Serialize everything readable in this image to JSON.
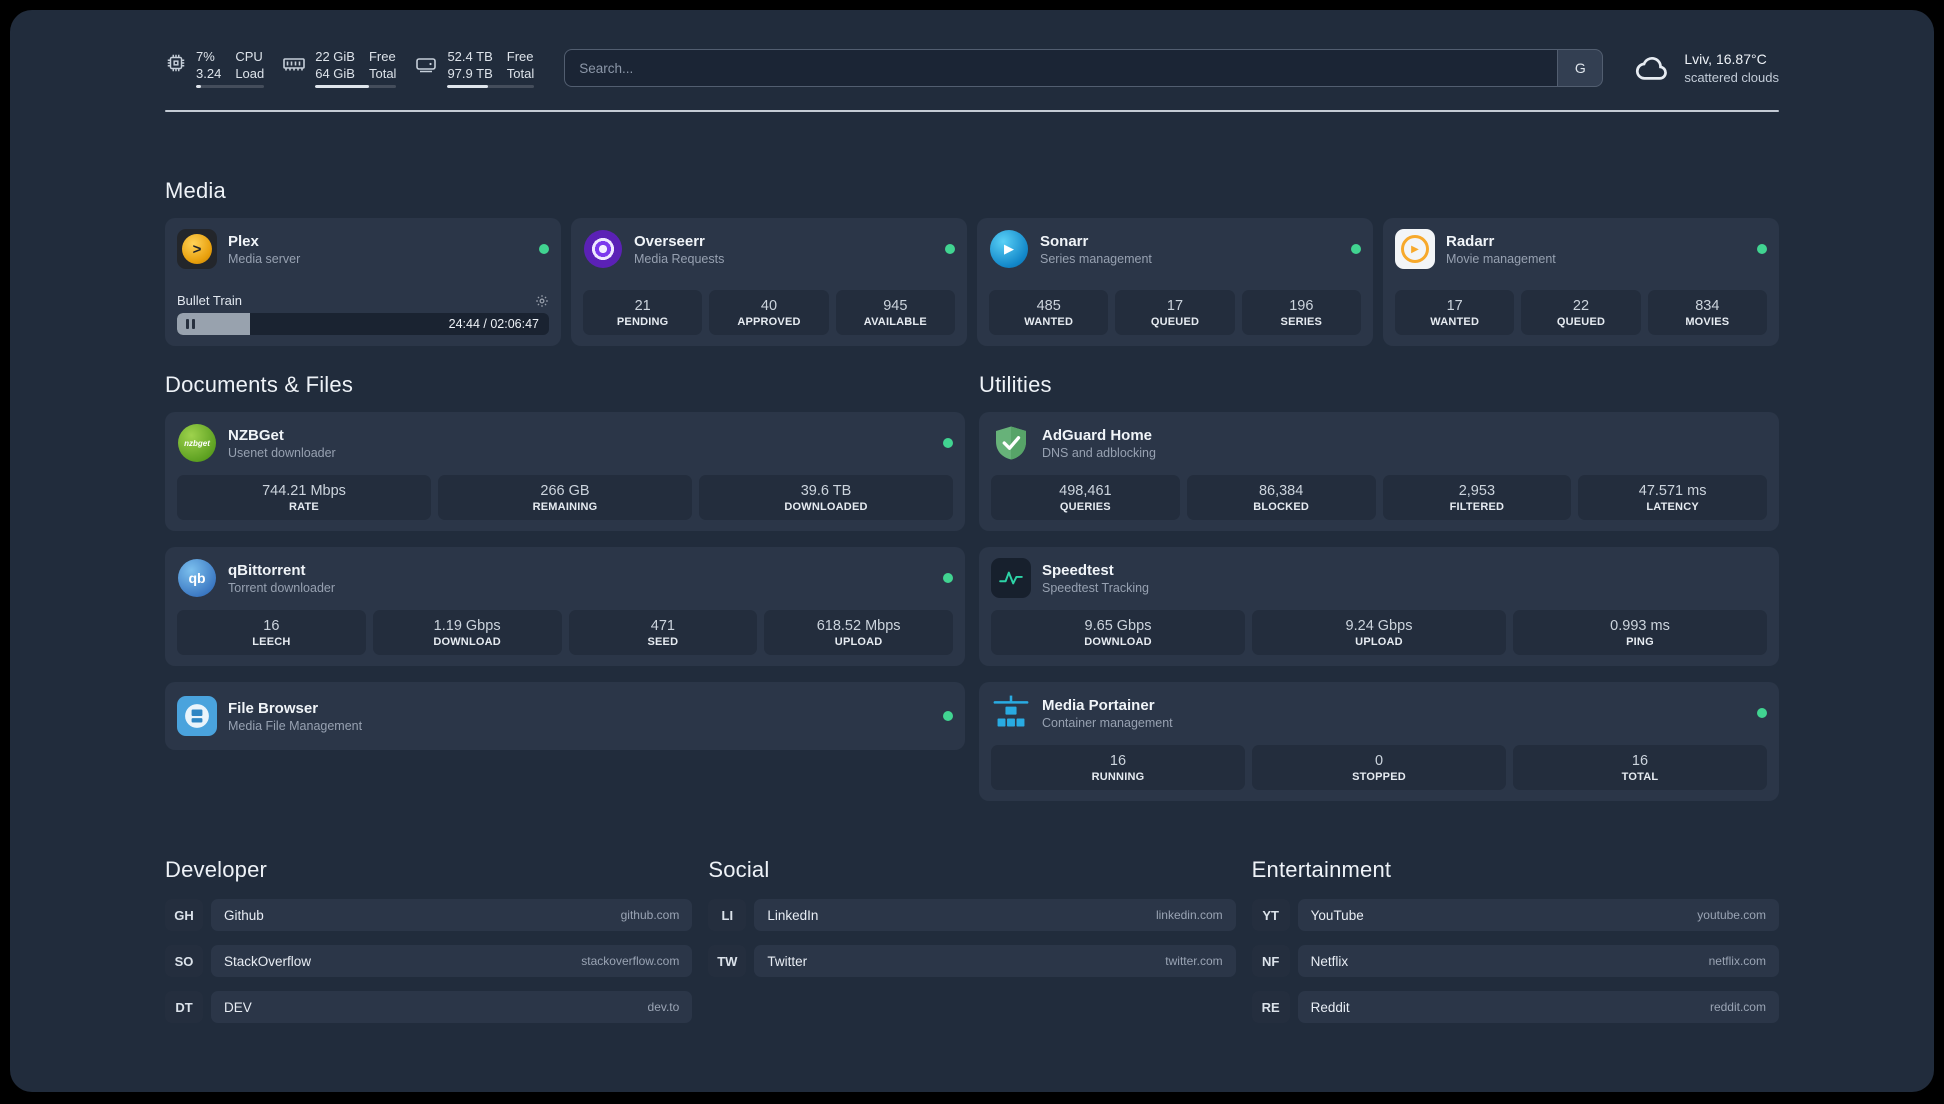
{
  "colors": {
    "status_online": "#41d491",
    "accent_blue": "#29abe2",
    "panel_bg": "#212c3c",
    "card_bg": "#2b3648"
  },
  "topbar": {
    "cpu": {
      "rows": [
        {
          "value": "7%",
          "label": "CPU"
        },
        {
          "value": "3.24",
          "label": "Load"
        }
      ],
      "bar_pct": 7
    },
    "memory": {
      "rows": [
        {
          "value": "22 GiB",
          "label": "Free"
        },
        {
          "value": "64 GiB",
          "label": "Total"
        }
      ],
      "bar_pct": 66
    },
    "disk": {
      "rows": [
        {
          "value": "52.4 TB",
          "label": "Free"
        },
        {
          "value": "97.9 TB",
          "label": "Total"
        }
      ],
      "bar_pct": 47
    },
    "search": {
      "placeholder": "Search...",
      "provider_label": "G"
    },
    "weather": {
      "location": "Lviv, 16.87°C",
      "condition": "scattered clouds"
    }
  },
  "media": {
    "title": "Media",
    "cards": [
      {
        "name": "Plex",
        "subtitle": "Media server",
        "status": "online",
        "player": {
          "title": "Bullet Train",
          "time": "24:44 / 02:06:47",
          "progress_pct": 19.5
        }
      },
      {
        "name": "Overseerr",
        "subtitle": "Media Requests",
        "status": "online",
        "stats": [
          {
            "value": "21",
            "label": "PENDING"
          },
          {
            "value": "40",
            "label": "APPROVED"
          },
          {
            "value": "945",
            "label": "AVAILABLE"
          }
        ]
      },
      {
        "name": "Sonarr",
        "subtitle": "Series management",
        "status": "online",
        "stats": [
          {
            "value": "485",
            "label": "WANTED"
          },
          {
            "value": "17",
            "label": "QUEUED"
          },
          {
            "value": "196",
            "label": "SERIES"
          }
        ]
      },
      {
        "name": "Radarr",
        "subtitle": "Movie management",
        "status": "online",
        "stats": [
          {
            "value": "17",
            "label": "WANTED"
          },
          {
            "value": "22",
            "label": "QUEUED"
          },
          {
            "value": "834",
            "label": "MOVIES"
          }
        ]
      }
    ]
  },
  "documents": {
    "title": "Documents & Files",
    "cards": [
      {
        "name": "NZBGet",
        "subtitle": "Usenet downloader",
        "status": "online",
        "stats": [
          {
            "value": "744.21 Mbps",
            "label": "RATE"
          },
          {
            "value": "266 GB",
            "label": "REMAINING"
          },
          {
            "value": "39.6 TB",
            "label": "DOWNLOADED"
          }
        ]
      },
      {
        "name": "qBittorrent",
        "subtitle": "Torrent downloader",
        "status": "online",
        "stats": [
          {
            "value": "16",
            "label": "LEECH"
          },
          {
            "value": "1.19 Gbps",
            "label": "DOWNLOAD"
          },
          {
            "value": "471",
            "label": "SEED"
          },
          {
            "value": "618.52 Mbps",
            "label": "UPLOAD"
          }
        ]
      },
      {
        "name": "File Browser",
        "subtitle": "Media File Management",
        "status": "online"
      }
    ]
  },
  "utilities": {
    "title": "Utilities",
    "cards": [
      {
        "name": "AdGuard Home",
        "subtitle": "DNS and adblocking",
        "stats": [
          {
            "value": "498,461",
            "label": "QUERIES"
          },
          {
            "value": "86,384",
            "label": "BLOCKED"
          },
          {
            "value": "2,953",
            "label": "FILTERED"
          },
          {
            "value": "47.571 ms",
            "label": "LATENCY"
          }
        ]
      },
      {
        "name": "Speedtest",
        "subtitle": "Speedtest Tracking",
        "stats": [
          {
            "value": "9.65 Gbps",
            "label": "DOWNLOAD"
          },
          {
            "value": "9.24 Gbps",
            "label": "UPLOAD"
          },
          {
            "value": "0.993 ms",
            "label": "PING"
          }
        ]
      },
      {
        "name": "Media Portainer",
        "subtitle": "Container management",
        "status": "online",
        "stats": [
          {
            "value": "16",
            "label": "RUNNING"
          },
          {
            "value": "0",
            "label": "STOPPED"
          },
          {
            "value": "16",
            "label": "TOTAL"
          }
        ]
      }
    ]
  },
  "bookmarks": [
    {
      "title": "Developer",
      "links": [
        {
          "abbr": "GH",
          "name": "Github",
          "domain": "github.com"
        },
        {
          "abbr": "SO",
          "name": "StackOverflow",
          "domain": "stackoverflow.com"
        },
        {
          "abbr": "DT",
          "name": "DEV",
          "domain": "dev.to"
        }
      ]
    },
    {
      "title": "Social",
      "links": [
        {
          "abbr": "LI",
          "name": "LinkedIn",
          "domain": "linkedin.com"
        },
        {
          "abbr": "TW",
          "name": "Twitter",
          "domain": "twitter.com"
        }
      ]
    },
    {
      "title": "Entertainment",
      "links": [
        {
          "abbr": "YT",
          "name": "YouTube",
          "domain": "youtube.com"
        },
        {
          "abbr": "NF",
          "name": "Netflix",
          "domain": "netflix.com"
        },
        {
          "abbr": "RE",
          "name": "Reddit",
          "domain": "reddit.com"
        }
      ]
    }
  ],
  "icons": {
    "plex_glyph": ">",
    "sonarr_glyph": "▶",
    "radarr_glyph": "▶",
    "nzbget_text": "nzbget",
    "qbittorrent_text": "qb"
  }
}
